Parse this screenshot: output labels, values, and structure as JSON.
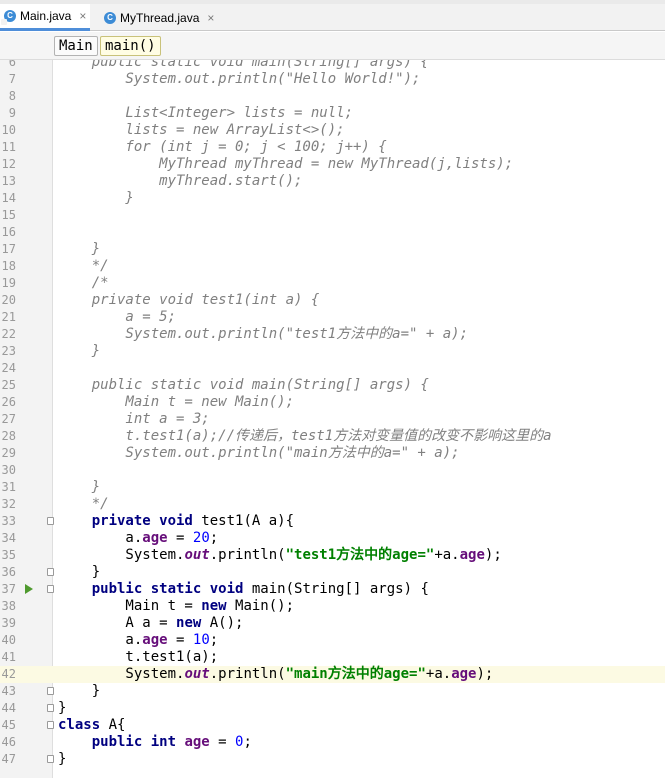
{
  "tabs": [
    {
      "label": "Main.java",
      "icon": "java-class-icon",
      "active": true
    },
    {
      "label": "MyThread.java",
      "icon": "java-class-icon",
      "active": false
    }
  ],
  "tab_close_glyph": "×",
  "class_icon_letter": "C",
  "breadcrumbs": [
    "Main",
    "main()"
  ],
  "current_line": "42",
  "lines": [
    {
      "n": "6",
      "html": "<span class=\"comment-line\">    public static void main(String[] args) {</span>",
      "comment": true
    },
    {
      "n": "7",
      "text": "        System.out.println(\"Hello World!\");",
      "comment": true
    },
    {
      "n": "8",
      "text": "",
      "comment": true
    },
    {
      "n": "9",
      "text": "        List<Integer> lists = null;",
      "comment": true
    },
    {
      "n": "10",
      "text": "        lists = new ArrayList<>();",
      "comment": true
    },
    {
      "n": "11",
      "text": "        for (int j = 0; j < 100; j++) {",
      "comment": true
    },
    {
      "n": "12",
      "text": "            MyThread myThread = new MyThread(j,lists);",
      "comment": true
    },
    {
      "n": "13",
      "text": "            myThread.start();",
      "comment": true
    },
    {
      "n": "14",
      "text": "        }",
      "comment": true
    },
    {
      "n": "15",
      "text": "",
      "comment": true
    },
    {
      "n": "16",
      "text": "",
      "comment": true
    },
    {
      "n": "17",
      "text": "    }",
      "comment": true
    },
    {
      "n": "18",
      "text": "    */",
      "comment": true
    },
    {
      "n": "19",
      "text": "    /*",
      "comment": true
    },
    {
      "n": "20",
      "text": "    private void test1(int a) {",
      "comment": true
    },
    {
      "n": "21",
      "text": "        a = 5;",
      "comment": true
    },
    {
      "n": "22",
      "text": "        System.out.println(\"test1方法中的a=\" + a);",
      "comment": true
    },
    {
      "n": "23",
      "text": "    }",
      "comment": true
    },
    {
      "n": "24",
      "text": "",
      "comment": true
    },
    {
      "n": "25",
      "text": "    public static void main(String[] args) {",
      "comment": true
    },
    {
      "n": "26",
      "text": "        Main t = new Main();",
      "comment": true
    },
    {
      "n": "27",
      "text": "        int a = 3;",
      "comment": true
    },
    {
      "n": "28",
      "text": "        t.test1(a);//传递后，test1方法对变量值的改变不影响这里的a",
      "comment": true
    },
    {
      "n": "29",
      "text": "        System.out.println(\"main方法中的a=\" + a);",
      "comment": true
    },
    {
      "n": "30",
      "text": "",
      "comment": true
    },
    {
      "n": "31",
      "text": "    }",
      "comment": true
    },
    {
      "n": "32",
      "text": "    */",
      "comment": true
    },
    {
      "n": "33",
      "tokens": [
        [
          "",
          "    "
        ],
        [
          "kw",
          "private void"
        ],
        [
          "",
          " test1(A a){"
        ]
      ],
      "fold": true
    },
    {
      "n": "34",
      "tokens": [
        [
          "",
          "        a."
        ],
        [
          "fld",
          "age"
        ],
        [
          "",
          " = "
        ],
        [
          "num",
          "20"
        ],
        [
          "",
          ";"
        ]
      ]
    },
    {
      "n": "35",
      "tokens": [
        [
          "",
          "        System."
        ],
        [
          "sfld",
          "out"
        ],
        [
          "",
          ".println("
        ],
        [
          "str",
          "\"test1方法中的age=\""
        ],
        [
          "",
          "+a."
        ],
        [
          "fld",
          "age"
        ],
        [
          "",
          ");"
        ]
      ]
    },
    {
      "n": "36",
      "tokens": [
        [
          "",
          "    }"
        ]
      ],
      "fold": true
    },
    {
      "n": "37",
      "tokens": [
        [
          "",
          "    "
        ],
        [
          "kw",
          "public static void"
        ],
        [
          "",
          " main(String[] args) {"
        ]
      ],
      "fold": true,
      "run": true
    },
    {
      "n": "38",
      "tokens": [
        [
          "",
          "        Main t = "
        ],
        [
          "kw",
          "new"
        ],
        [
          "",
          " Main();"
        ]
      ]
    },
    {
      "n": "39",
      "tokens": [
        [
          "",
          "        A a = "
        ],
        [
          "kw",
          "new"
        ],
        [
          "",
          " A();"
        ]
      ]
    },
    {
      "n": "40",
      "tokens": [
        [
          "",
          "        a."
        ],
        [
          "fld",
          "age"
        ],
        [
          "",
          " = "
        ],
        [
          "num",
          "10"
        ],
        [
          "",
          ";"
        ]
      ]
    },
    {
      "n": "41",
      "tokens": [
        [
          "",
          "        t.test1(a);"
        ]
      ]
    },
    {
      "n": "42",
      "tokens": [
        [
          "",
          "        System."
        ],
        [
          "sfld",
          "out"
        ],
        [
          "",
          ".println("
        ],
        [
          "str",
          "\"main方法中的age=\""
        ],
        [
          "",
          "+a."
        ],
        [
          "fld",
          "age"
        ],
        [
          "",
          ");"
        ]
      ]
    },
    {
      "n": "43",
      "tokens": [
        [
          "",
          "    }"
        ]
      ],
      "fold": true
    },
    {
      "n": "44",
      "tokens": [
        [
          "",
          "}"
        ]
      ],
      "fold": true
    },
    {
      "n": "45",
      "tokens": [
        [
          "kw",
          "class"
        ],
        [
          "",
          " A{"
        ]
      ],
      "fold": true
    },
    {
      "n": "46",
      "tokens": [
        [
          "",
          "    "
        ],
        [
          "kw",
          "public int"
        ],
        [
          "",
          " "
        ],
        [
          "fld",
          "age"
        ],
        [
          "",
          " = "
        ],
        [
          "num",
          "0"
        ],
        [
          "",
          ";"
        ]
      ]
    },
    {
      "n": "47",
      "tokens": [
        [
          "",
          "}"
        ]
      ],
      "fold": true
    }
  ]
}
